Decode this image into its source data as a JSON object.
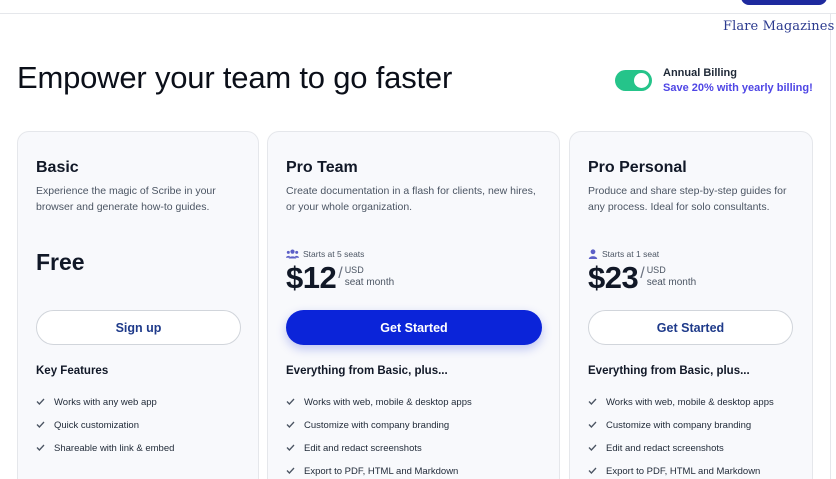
{
  "watermark": "Flare Magazines",
  "headline": "Empower your team to go faster",
  "billing": {
    "toggle_on": true,
    "label": "Annual Billing",
    "sub": "Save 20% with yearly billing!",
    "toggle_color": "#25c48a"
  },
  "plans": [
    {
      "title": "Basic",
      "description": "Experience the magic of Scribe in your browser and generate how-to guides.",
      "price_text": "Free",
      "button": "Sign up",
      "features_heading": "Key Features",
      "features": [
        "Works with any web app",
        "Quick customization",
        "Shareable with link & embed"
      ]
    },
    {
      "title": "Pro Team",
      "description": "Create documentation in a flash for clients, new hires, or your whole organization.",
      "seats": "Starts at 5 seats",
      "seats_icon": "users-icon",
      "price": "$12",
      "currency": "USD",
      "per": "seat month",
      "button": "Get Started",
      "features_heading": "Everything from Basic, plus...",
      "features": [
        "Works with web, mobile & desktop apps",
        "Customize with company branding",
        "Edit and redact screenshots",
        "Export to PDF, HTML and Markdown"
      ]
    },
    {
      "title": "Pro Personal",
      "description": "Produce and share step-by-step guides for any process. Ideal for solo consultants.",
      "seats": "Starts at 1 seat",
      "seats_icon": "user-icon",
      "price": "$23",
      "currency": "USD",
      "per": "seat month",
      "button": "Get Started",
      "features_heading": "Everything from Basic, plus...",
      "features": [
        "Works with web, mobile & desktop apps",
        "Customize with company branding",
        "Edit and redact screenshots",
        "Export to PDF, HTML and Markdown"
      ]
    }
  ],
  "colors": {
    "primary_button": "#0b24d9",
    "accent_text": "#4f46e5",
    "watermark": "#2b3a8f"
  }
}
